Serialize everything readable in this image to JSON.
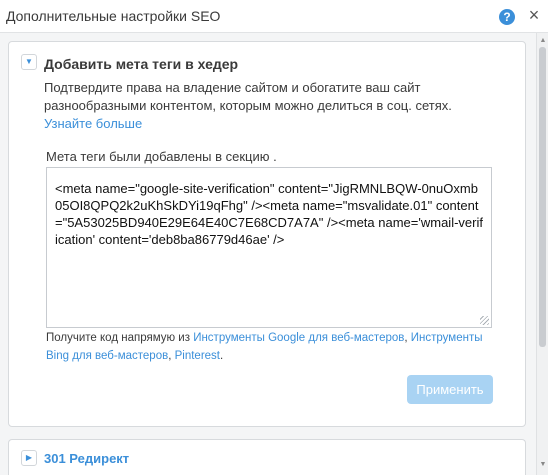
{
  "header": {
    "title": "Дополнительные настройки SEO",
    "help_label": "?",
    "close_label": "×"
  },
  "section": {
    "title": "Добавить мета теги в хедер",
    "description": "Подтвердите права на владение сайтом и обогатите ваш сайт разнообразными контентом, которым можно делиться в соц. сетях.",
    "learn_more": "Узнайте больше",
    "info": "Мета теги были добавлены в секцию .",
    "meta_value": "<meta name=\"google-site-verification\" content=\"JigRMNLBQW-0nuOxmb05OI8QPQ2k2uKhSkDYi19qFhg\" /><meta name=\"msvalidate.01\" content=\"5A53025BD940E29E64E40C7E68CD7A7A\" /><meta name='wmail-verification' content='deb8ba86779d46ae' />",
    "footer_prefix": "Получите код напрямую из ",
    "link_google": "Инструменты Google для веб-мастеров",
    "sep1": ", ",
    "link_bing": "Инструменты Bing для веб-мастеров",
    "sep2": ", ",
    "link_pinterest": "Pinterest",
    "footer_suffix": ".",
    "apply_label": "Применить"
  },
  "redirect": {
    "title": "301 Редирект"
  },
  "icons": {
    "expanded_toggle": "chevron-down-icon",
    "collapsed_toggle": "chevron-right-icon",
    "help": "help-icon",
    "close": "close-icon"
  },
  "colors": {
    "accent": "#3b8fd9",
    "button_disabled": "#a9d3f3",
    "background": "#f4f5f6"
  }
}
